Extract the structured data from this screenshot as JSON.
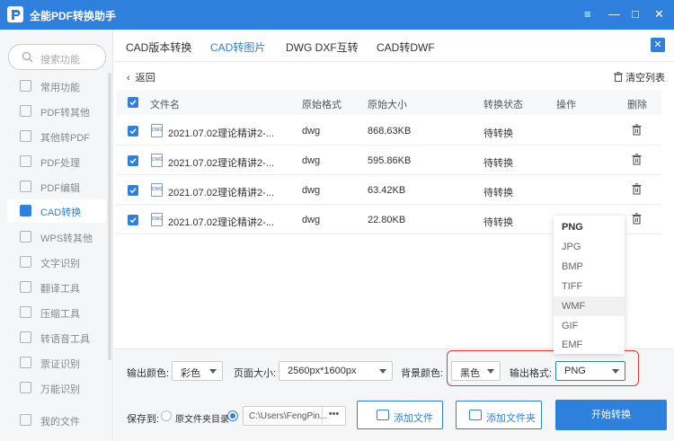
{
  "app": {
    "title": "全能PDF转换助手",
    "accent": "#2f7fdc",
    "highlight_color": "#e03c2c"
  },
  "window": {
    "buttons": [
      "≡",
      "—",
      "□",
      "✕"
    ]
  },
  "sidebar": {
    "search_placeholder": "搜索功能",
    "items": [
      {
        "label": "常用功能",
        "icon": "star-icon"
      },
      {
        "label": "PDF转其他",
        "icon": "pdf-convert-icon"
      },
      {
        "label": "其他转PDF",
        "icon": "to-pdf-icon"
      },
      {
        "label": "PDF处理",
        "icon": "pdf-process-icon"
      },
      {
        "label": "PDF编辑",
        "icon": "pdf-edit-icon"
      },
      {
        "label": "CAD转换",
        "icon": "cad-icon",
        "active": true
      },
      {
        "label": "WPS转其他",
        "icon": "wps-icon"
      },
      {
        "label": "文字识别",
        "icon": "ocr-icon"
      },
      {
        "label": "翻译工具",
        "icon": "translate-icon"
      },
      {
        "label": "压缩工具",
        "icon": "compress-icon"
      },
      {
        "label": "转语音工具",
        "icon": "voice-icon"
      },
      {
        "label": "票证识别",
        "icon": "ticket-icon"
      },
      {
        "label": "万能识别",
        "icon": "scan-icon"
      }
    ],
    "my_files": "我的文件"
  },
  "tabs": [
    "CAD版本转换",
    "CAD转图片",
    "DWG DXF互转",
    "CAD转DWF"
  ],
  "active_tab": 1,
  "toolbar": {
    "back": "返回",
    "clear": "清空列表"
  },
  "table": {
    "headers": [
      "文件名",
      "原始格式",
      "原始大小",
      "转换状态",
      "操作",
      "删除"
    ],
    "rows": [
      {
        "name": "2021.07.02理论精讲2-...",
        "format": "dwg",
        "size": "868.63KB",
        "status": "待转换"
      },
      {
        "name": "2021.07.02理论精讲2-...",
        "format": "dwg",
        "size": "595.86KB",
        "status": "待转换"
      },
      {
        "name": "2021.07.02理论精讲2-...",
        "format": "dwg",
        "size": "63.42KB",
        "status": "待转换"
      },
      {
        "name": "2021.07.02理论精讲2-...",
        "format": "dwg",
        "size": "22.80KB",
        "status": "待转换"
      }
    ]
  },
  "format_dropdown": {
    "options": [
      "PNG",
      "JPG",
      "BMP",
      "TIFF",
      "WMF",
      "GIF",
      "EMF"
    ]
  },
  "settings": {
    "output_color_label": "输出颜色:",
    "output_color": "彩色",
    "page_size_label": "页面大小:",
    "page_size": "2560px*1600px",
    "bg_color_label": "背景颜色:",
    "bg_color": "黑色",
    "output_format_label": "输出格式:",
    "output_format": "PNG"
  },
  "save": {
    "label": "保存到:",
    "option_source": "原文件夹目录",
    "path": "C:\\Users\\FengPin...",
    "more": "•••"
  },
  "buttons": {
    "add_file": "添加文件",
    "add_folder": "添加文件夹",
    "start": "开始转换"
  }
}
